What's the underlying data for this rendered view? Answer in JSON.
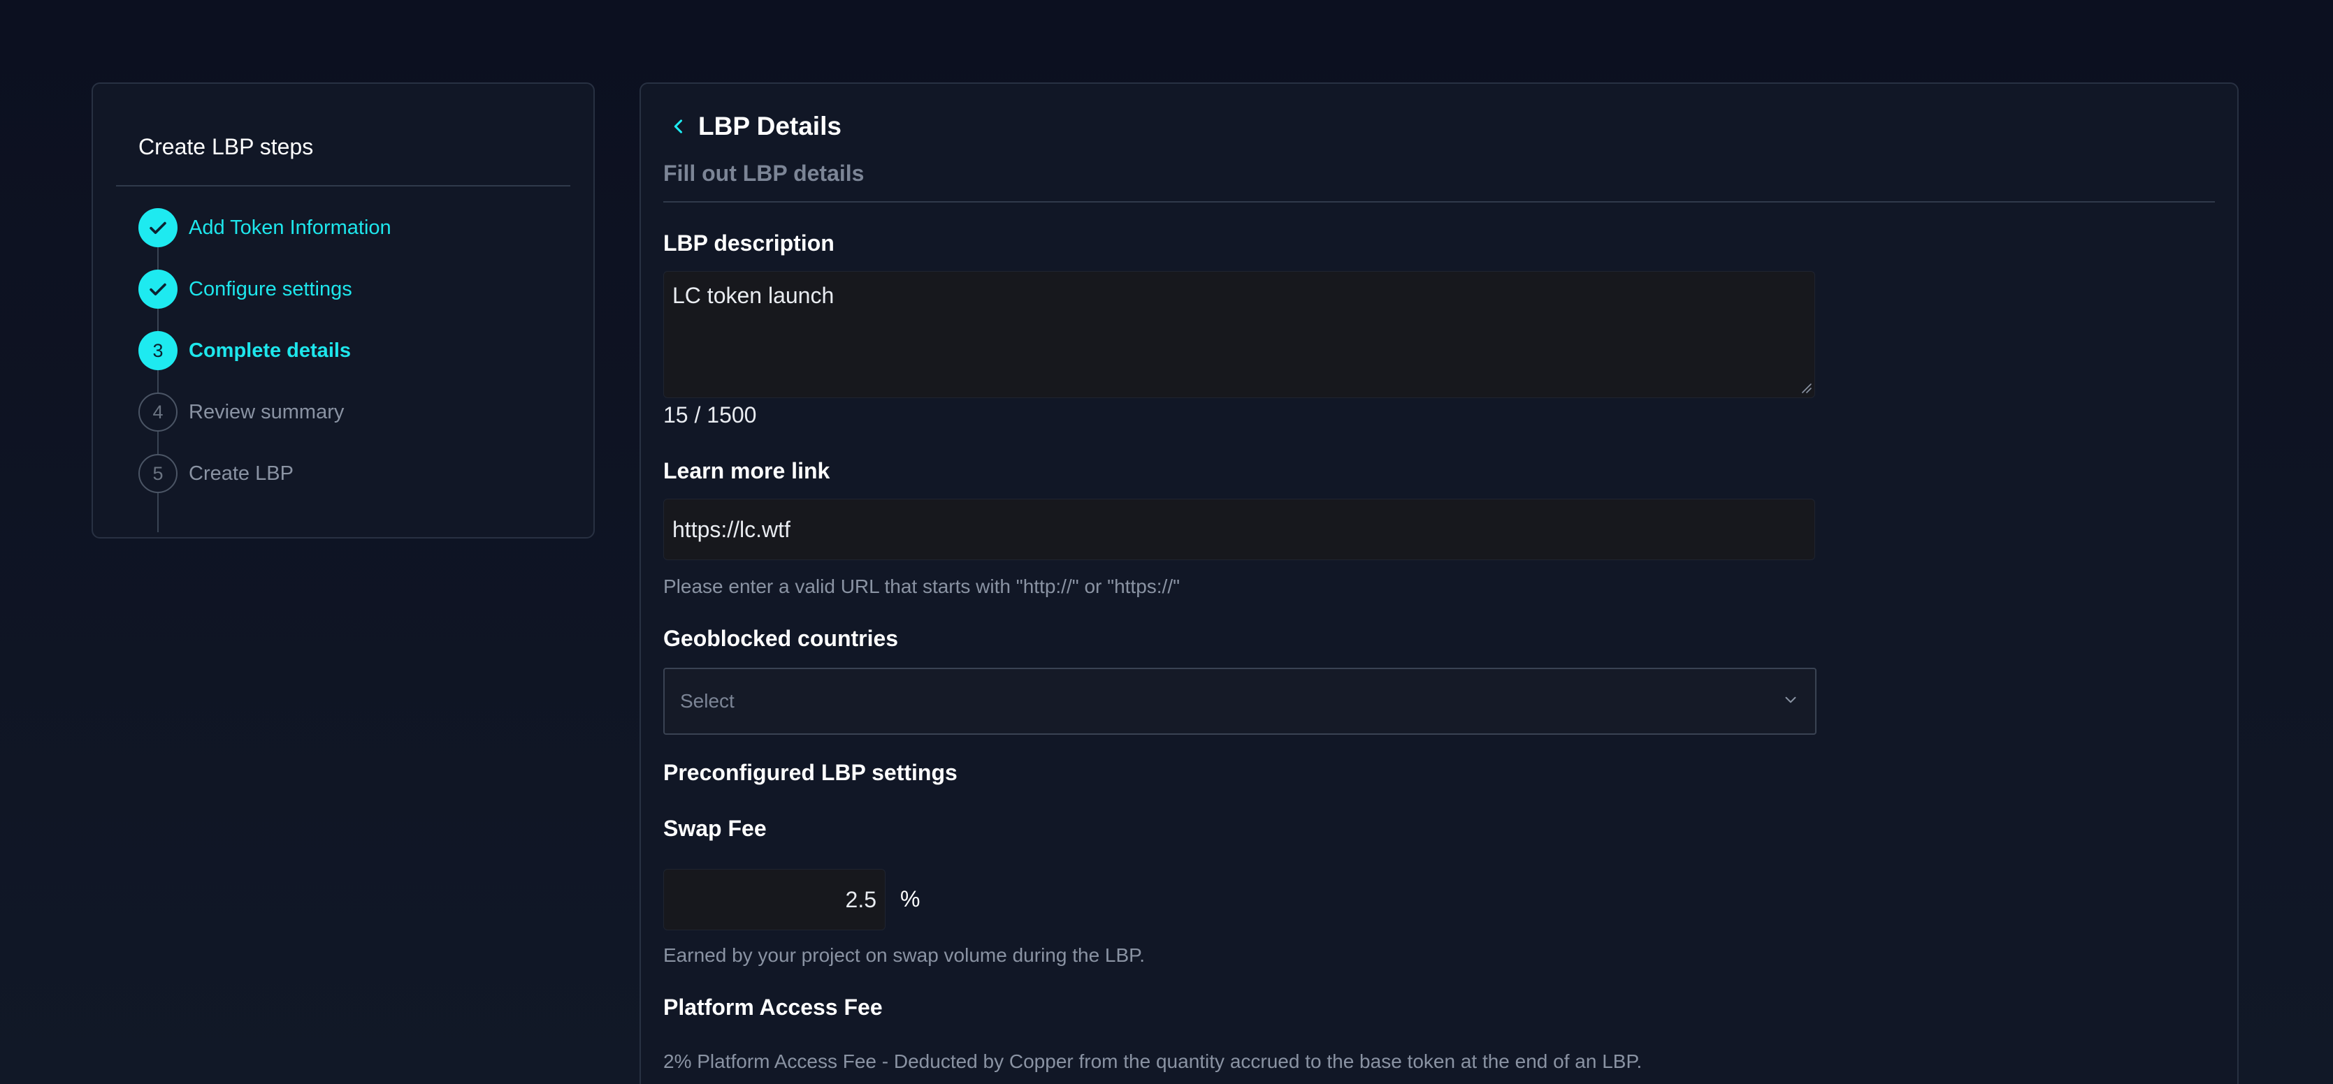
{
  "steps_panel": {
    "title": "Create LBP steps",
    "steps": [
      {
        "label": "Add Token Information",
        "number": "1",
        "state": "done"
      },
      {
        "label": "Configure settings",
        "number": "2",
        "state": "done"
      },
      {
        "label": "Complete details",
        "number": "3",
        "state": "active"
      },
      {
        "label": "Review summary",
        "number": "4",
        "state": "todo"
      },
      {
        "label": "Create LBP",
        "number": "5",
        "state": "todo"
      }
    ]
  },
  "main": {
    "title": "LBP Details",
    "subtitle": "Fill out LBP details",
    "description": {
      "label": "LBP description",
      "value": "LC token launch",
      "counter": "15 / 1500"
    },
    "learn_more": {
      "label": "Learn more link",
      "value": "https://lc.wtf",
      "helper": "Please enter a valid URL that starts with \"http://\" or \"https://\""
    },
    "geoblocked": {
      "label": "Geoblocked countries",
      "placeholder": "Select"
    },
    "preconfigured_heading": "Preconfigured LBP settings",
    "swap_fee": {
      "label": "Swap Fee",
      "value": "2.5",
      "unit": "%",
      "helper": "Earned by your project on swap volume during the LBP."
    },
    "platform_fee": {
      "label": "Platform Access Fee",
      "helper": "2% Platform Access Fee - Deducted by Copper from the quantity accrued to the base token at the end of an LBP."
    }
  },
  "colors": {
    "accent": "#1eeaf0",
    "background": "#0d1120",
    "panel": "#111726",
    "muted_text": "#8a93a3"
  }
}
